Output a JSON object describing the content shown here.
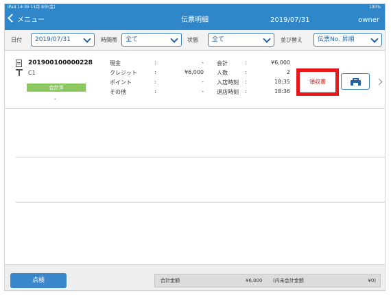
{
  "status_bar": {
    "left": "iPad  14:35  11月 8日(金)",
    "center": "",
    "right": "100%"
  },
  "nav": {
    "back_label": "メニュー",
    "title": "伝票明細",
    "date": "2019/07/31",
    "user": "owner"
  },
  "filters": [
    {
      "label": "日付",
      "value": "2019/07/31"
    },
    {
      "label": "時間帯",
      "value": "全て"
    },
    {
      "label": "状態",
      "value": "全て"
    },
    {
      "label": "並び替え",
      "value": "伝票No. 昇順"
    }
  ],
  "record": {
    "slip_no": "201900100000228",
    "table": "C1",
    "status_badge": "会計済",
    "dash": "-",
    "payments": [
      {
        "label": "現金",
        "value": "-"
      },
      {
        "label": "クレジット",
        "value": "¥6,000"
      },
      {
        "label": "ポイント",
        "value": "-"
      },
      {
        "label": "その他",
        "value": "-"
      }
    ],
    "details": [
      {
        "label": "会計",
        "value": "¥6,000"
      },
      {
        "label": "人数",
        "value": "2"
      },
      {
        "label": "入店時刻",
        "value": "18:35"
      },
      {
        "label": "退店時刻",
        "value": "18:36"
      }
    ],
    "colon": ":",
    "receipt_button": "領収書"
  },
  "footer": {
    "check_button": "点検",
    "total_label": "合計金額",
    "total_value": "¥6,000",
    "tax_label": "(内未会計金額",
    "tax_value": "¥0)"
  },
  "colors": {
    "accent": "#2f86c9",
    "highlight": "#e8171a",
    "badge": "#8cc85f"
  }
}
